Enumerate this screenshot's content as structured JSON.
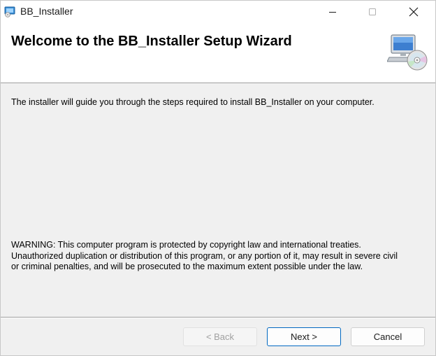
{
  "window": {
    "title": "BB_Installer",
    "controls": {
      "minimize_icon": "minimize-icon",
      "maximize_icon": "maximize-icon",
      "close_icon": "close-icon"
    }
  },
  "header": {
    "title": "Welcome to the BB_Installer Setup Wizard",
    "icon": "computer-cd-icon"
  },
  "body": {
    "intro": "The installer will guide you through the steps required to install BB_Installer on your computer.",
    "warning_lines": [
      "WARNING: This computer program is protected by copyright law and international treaties.",
      "Unauthorized duplication or distribution of this program, or any portion of it, may result in severe civil",
      "or criminal penalties, and will be prosecuted to the maximum extent possible under the law."
    ]
  },
  "buttons": {
    "back": "< Back",
    "next": "Next >",
    "cancel": "Cancel",
    "back_enabled": false
  },
  "colors": {
    "accent": "#0067c0",
    "window_bg": "#f0f0f0",
    "header_bg": "#ffffff",
    "disabled_text": "#a0a0a0"
  }
}
